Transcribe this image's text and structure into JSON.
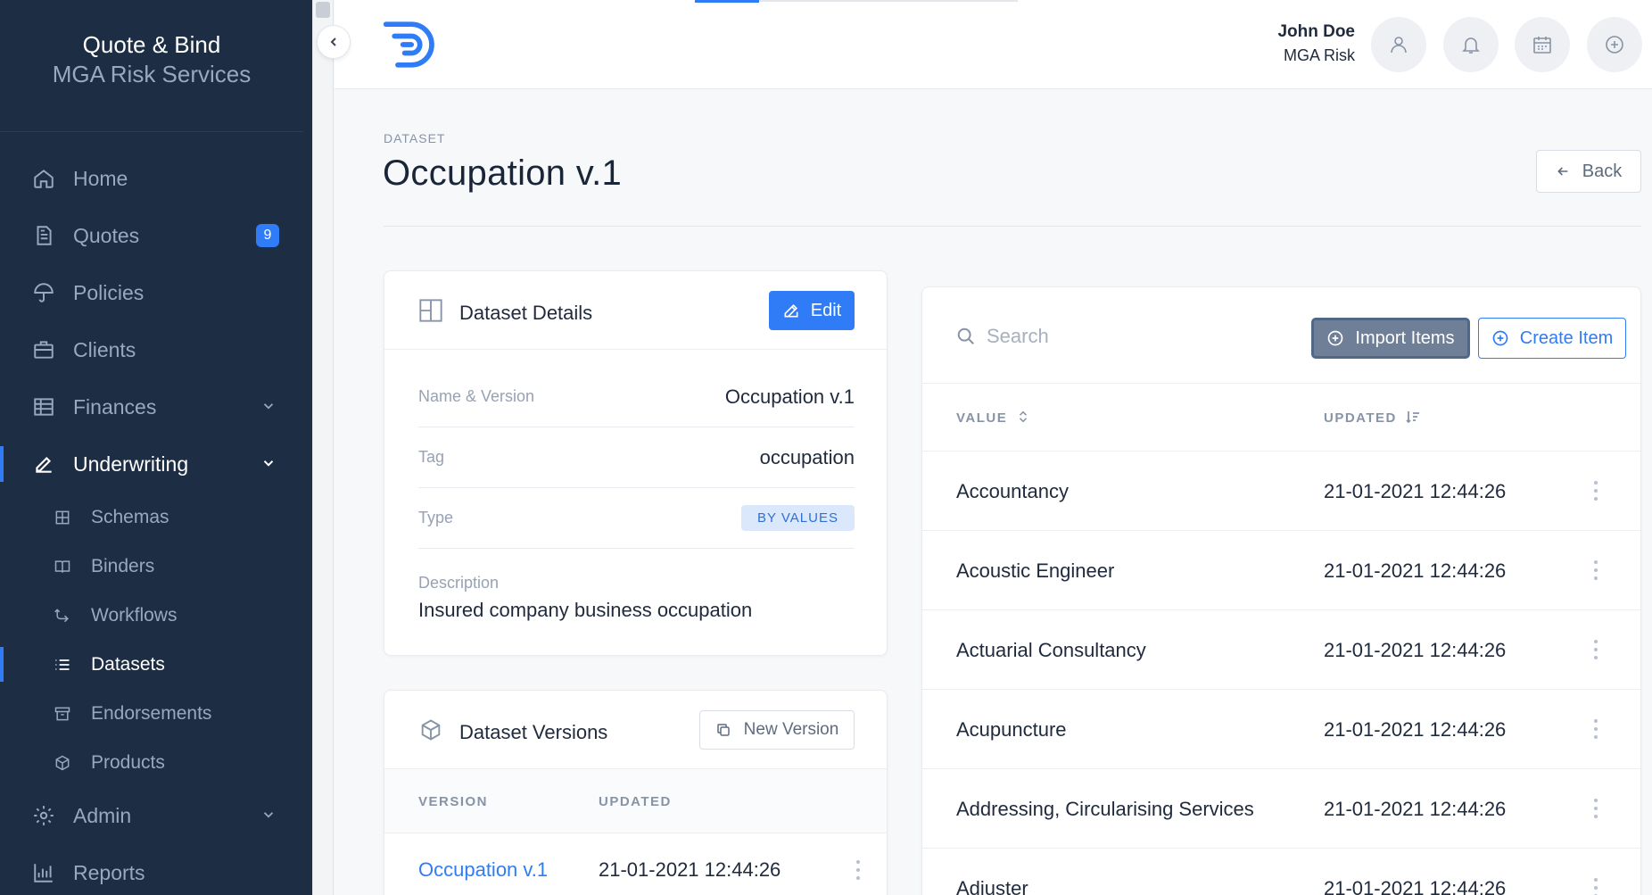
{
  "brand": {
    "line1": "Quote & Bind",
    "line2": "MGA Risk Services"
  },
  "nav": {
    "home": "Home",
    "quotes": "Quotes",
    "quotes_badge": "9",
    "policies": "Policies",
    "clients": "Clients",
    "finances": "Finances",
    "underwriting": "Underwriting",
    "sub": {
      "schemas": "Schemas",
      "binders": "Binders",
      "workflows": "Workflows",
      "datasets": "Datasets",
      "endorsements": "Endorsements",
      "products": "Products"
    },
    "admin": "Admin",
    "reports": "Reports"
  },
  "user": {
    "name": "John Doe",
    "org": "MGA Risk"
  },
  "page": {
    "breadcrumb": "DATASET",
    "title": "Occupation v.1",
    "back_label": "Back"
  },
  "details": {
    "title": "Dataset Details",
    "edit_label": "Edit",
    "name_label": "Name & Version",
    "name_value": "Occupation v.1",
    "tag_label": "Tag",
    "tag_value": "occupation",
    "type_label": "Type",
    "type_value": "BY VALUES",
    "desc_label": "Description",
    "desc_value": "Insured company business occupation"
  },
  "versions": {
    "title": "Dataset Versions",
    "new_label": "New Version",
    "col_version": "VERSION",
    "col_updated": "UPDATED",
    "rows": [
      {
        "version": "Occupation v.1",
        "updated": "21-01-2021 12:44:26"
      }
    ]
  },
  "items": {
    "search_placeholder": "Search",
    "import_label": "Import Items",
    "create_label": "Create Item",
    "col_value": "VALUE",
    "col_updated": "UPDATED",
    "rows": [
      {
        "value": "Accountancy",
        "updated": "21-01-2021 12:44:26"
      },
      {
        "value": "Acoustic Engineer",
        "updated": "21-01-2021 12:44:26"
      },
      {
        "value": "Actuarial Consultancy",
        "updated": "21-01-2021 12:44:26"
      },
      {
        "value": "Acupuncture",
        "updated": "21-01-2021 12:44:26"
      },
      {
        "value": "Addressing, Circularising Services",
        "updated": "21-01-2021 12:44:26"
      },
      {
        "value": "Adjuster",
        "updated": "21-01-2021 12:44:26"
      }
    ]
  },
  "colors": {
    "sidebar": "#1c2d44",
    "accent": "#2f7cf6",
    "muted": "#9aa8bd"
  },
  "icons": [
    "home-icon",
    "file-icon",
    "umbrella-icon",
    "briefcase-icon",
    "finance-icon",
    "pen-icon",
    "layout-icon",
    "book-icon",
    "workflow-icon",
    "list-icon",
    "archive-icon",
    "cube-icon",
    "gear-icon",
    "chart-icon",
    "user-icon",
    "bell-icon",
    "calendar-icon",
    "plus-circle-icon",
    "search-icon",
    "copy-icon",
    "sort-icon"
  ]
}
